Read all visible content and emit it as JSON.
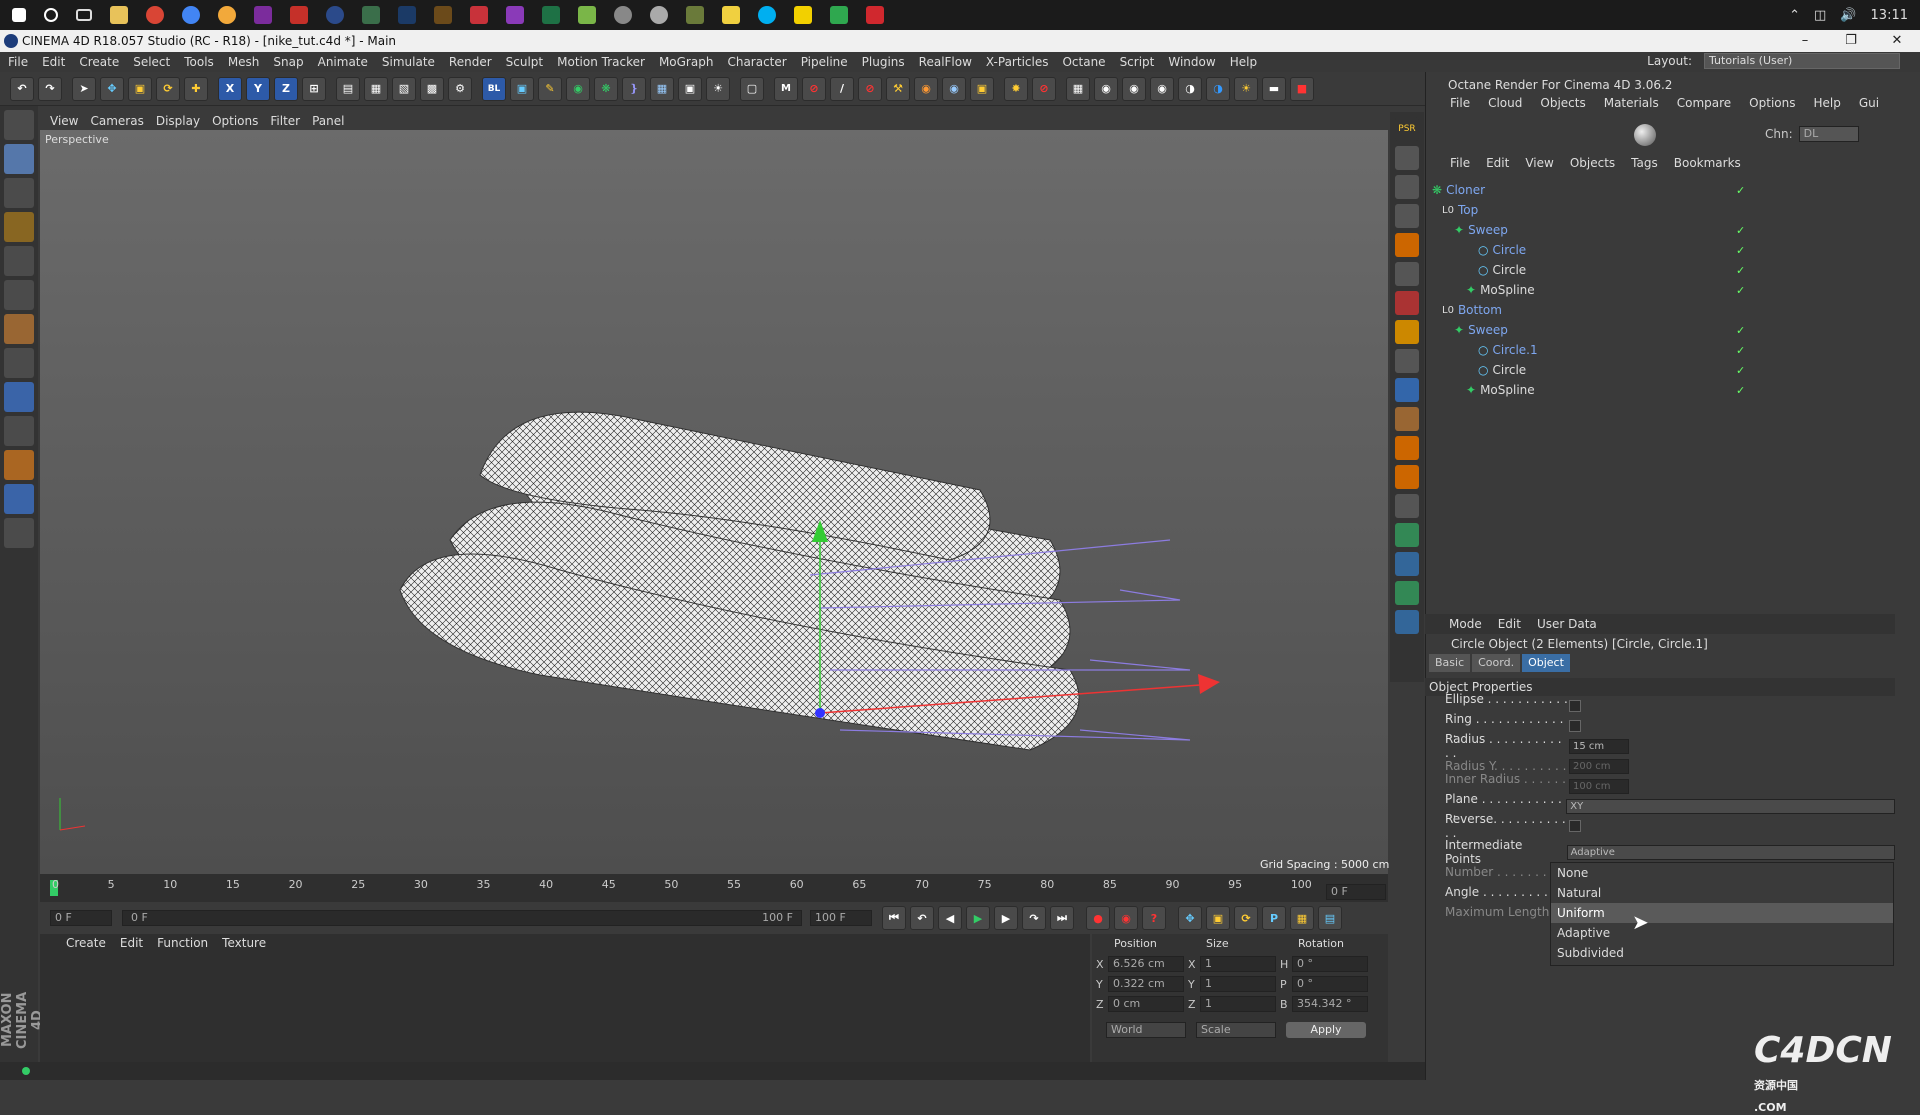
{
  "taskbar": {
    "time": "13:11"
  },
  "window": {
    "title": "CINEMA 4D R18.057 Studio (RC - R18) - [nike_tut.c4d *] - Main",
    "minimize": "–",
    "maximize": "❐",
    "close": "✕"
  },
  "menu": [
    "File",
    "Edit",
    "Create",
    "Select",
    "Tools",
    "Mesh",
    "Snap",
    "Animate",
    "Simulate",
    "Render",
    "Sculpt",
    "Motion Tracker",
    "MoGraph",
    "Character",
    "Pipeline",
    "Plugins",
    "RealFlow",
    "X-Particles",
    "Octane",
    "Script",
    "Window",
    "Help"
  ],
  "layout": {
    "label": "Layout:",
    "value": "Tutorials (User)"
  },
  "toolbar": {
    "axis_x": "X",
    "axis_y": "Y",
    "axis_z": "Z"
  },
  "viewport": {
    "menu": [
      "View",
      "Cameras",
      "Display",
      "Options",
      "Filter",
      "Panel"
    ],
    "label": "Perspective",
    "grid_spacing": "Grid Spacing : 5000 cm"
  },
  "timeline": {
    "ticks": [
      "0",
      "5",
      "10",
      "15",
      "20",
      "25",
      "30",
      "35",
      "40",
      "45",
      "50",
      "55",
      "60",
      "65",
      "70",
      "75",
      "80",
      "85",
      "90",
      "95",
      "100"
    ],
    "current_frame": "0 F",
    "start_field": "0 F",
    "range_start": "0 F",
    "range_end": "100 F",
    "end_field": "100 F"
  },
  "material_manager": {
    "menu": [
      "Create",
      "Edit",
      "Function",
      "Texture"
    ]
  },
  "coordinates": {
    "headers": [
      "Position",
      "Size",
      "Rotation"
    ],
    "rows": [
      {
        "axis": "X",
        "pos": "6.526 cm",
        "size_axis": "X",
        "size": "1",
        "rot_axis": "H",
        "rot": "0 °"
      },
      {
        "axis": "Y",
        "pos": "0.322 cm",
        "size_axis": "Y",
        "size": "1",
        "rot_axis": "P",
        "rot": "0 °"
      },
      {
        "axis": "Z",
        "pos": "0 cm",
        "size_axis": "Z",
        "size": "1",
        "rot_axis": "B",
        "rot": "354.342 °"
      }
    ],
    "world": "World",
    "scale": "Scale",
    "apply": "Apply"
  },
  "brand": {
    "maxon": "MAXON CINEMA 4D"
  },
  "octane": {
    "title": "Octane Render For Cinema 4D 3.06.2",
    "menu": [
      "File",
      "Cloud",
      "Objects",
      "Materials",
      "Compare",
      "Options",
      "Help",
      "Gui"
    ],
    "chn_label": "Chn:",
    "chn_value": "DL"
  },
  "object_manager": {
    "menu": [
      "File",
      "Edit",
      "View",
      "Objects",
      "Tags",
      "Bookmarks"
    ],
    "items": [
      {
        "name": "Cloner",
        "depth": 0,
        "color": "blue"
      },
      {
        "name": "Top",
        "depth": 1,
        "color": "blue"
      },
      {
        "name": "Sweep",
        "depth": 2,
        "color": "blue"
      },
      {
        "name": "Circle",
        "depth": 3,
        "color": "blue"
      },
      {
        "name": "Circle",
        "depth": 3,
        "color": "white"
      },
      {
        "name": "MoSpline",
        "depth": 2,
        "color": "white"
      },
      {
        "name": "Bottom",
        "depth": 1,
        "color": "blue"
      },
      {
        "name": "Sweep",
        "depth": 2,
        "color": "blue"
      },
      {
        "name": "Circle.1",
        "depth": 3,
        "color": "blue"
      },
      {
        "name": "Circle",
        "depth": 3,
        "color": "white"
      },
      {
        "name": "MoSpline",
        "depth": 2,
        "color": "white"
      }
    ]
  },
  "attributes": {
    "menu": [
      "Mode",
      "Edit",
      "User Data"
    ],
    "header": "Circle Object (2 Elements) [Circle, Circle.1]",
    "tabs": [
      "Basic",
      "Coord.",
      "Object"
    ],
    "active_tab": "Object",
    "section": "Object Properties",
    "props": [
      {
        "label": "Ellipse . . . . . . . . . . . .",
        "type": "checkbox"
      },
      {
        "label": "Ring . . . . . . . . . . . . . .",
        "type": "checkbox"
      },
      {
        "label": "Radius . . . . . . . . . . . .",
        "type": "value",
        "value": "15 cm"
      },
      {
        "label": "Radius Y. . . . . . . . . .",
        "type": "value",
        "value": "200 cm",
        "dim": true
      },
      {
        "label": "Inner Radius . . . . . . .",
        "type": "value",
        "value": "100 cm",
        "dim": true
      },
      {
        "label": "Plane . . . . . . . . . . . . .",
        "type": "select",
        "value": "XY"
      },
      {
        "label": "Reverse. . . . . . . . . . . .",
        "type": "checkbox"
      }
    ],
    "intermediate_label": "Intermediate Points",
    "intermediate_value": "Adaptive",
    "number_label": "Number . . . . . . . . .",
    "angle_label": "Angle . . . . . . . . . .",
    "maxlen_label": "Maximum Length ."
  },
  "dropdown": {
    "options": [
      "None",
      "Natural",
      "Uniform",
      "Adaptive",
      "Subdivided"
    ],
    "highlighted": "Uniform"
  },
  "watermark": {
    "text": "C4DCN",
    "sub1": "资源中国",
    "sub2": ".COM"
  },
  "colors": {
    "accent": "#3a6ea5",
    "check": "#66ff66",
    "tree_blue": "#7ea7f0"
  }
}
